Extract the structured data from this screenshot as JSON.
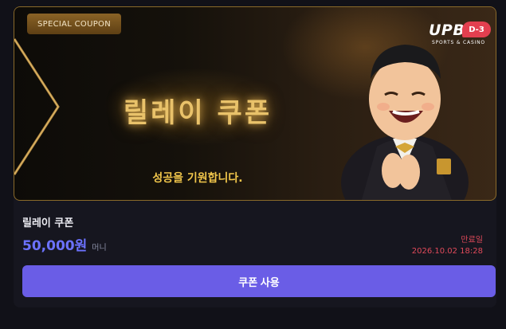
{
  "banner": {
    "tag": "SPECIAL COUPON",
    "title": "릴레이 쿠폰",
    "subtitle": "성공을 기원합니다.",
    "logo_text": "UPBET",
    "logo_sub": "SPORTS & CASINO",
    "dday": "D-3"
  },
  "coupon": {
    "name": "릴레이 쿠폰",
    "amount": "50,000원",
    "unit": "머니",
    "expiry_label": "만료일",
    "expiry_date": "2026.10.02 18:28",
    "use_button": "쿠폰 사용"
  },
  "colors": {
    "accent": "#6a5de6",
    "amount": "#6c72ff",
    "expiry": "#e04a5a",
    "gold": "#e9c26a"
  }
}
